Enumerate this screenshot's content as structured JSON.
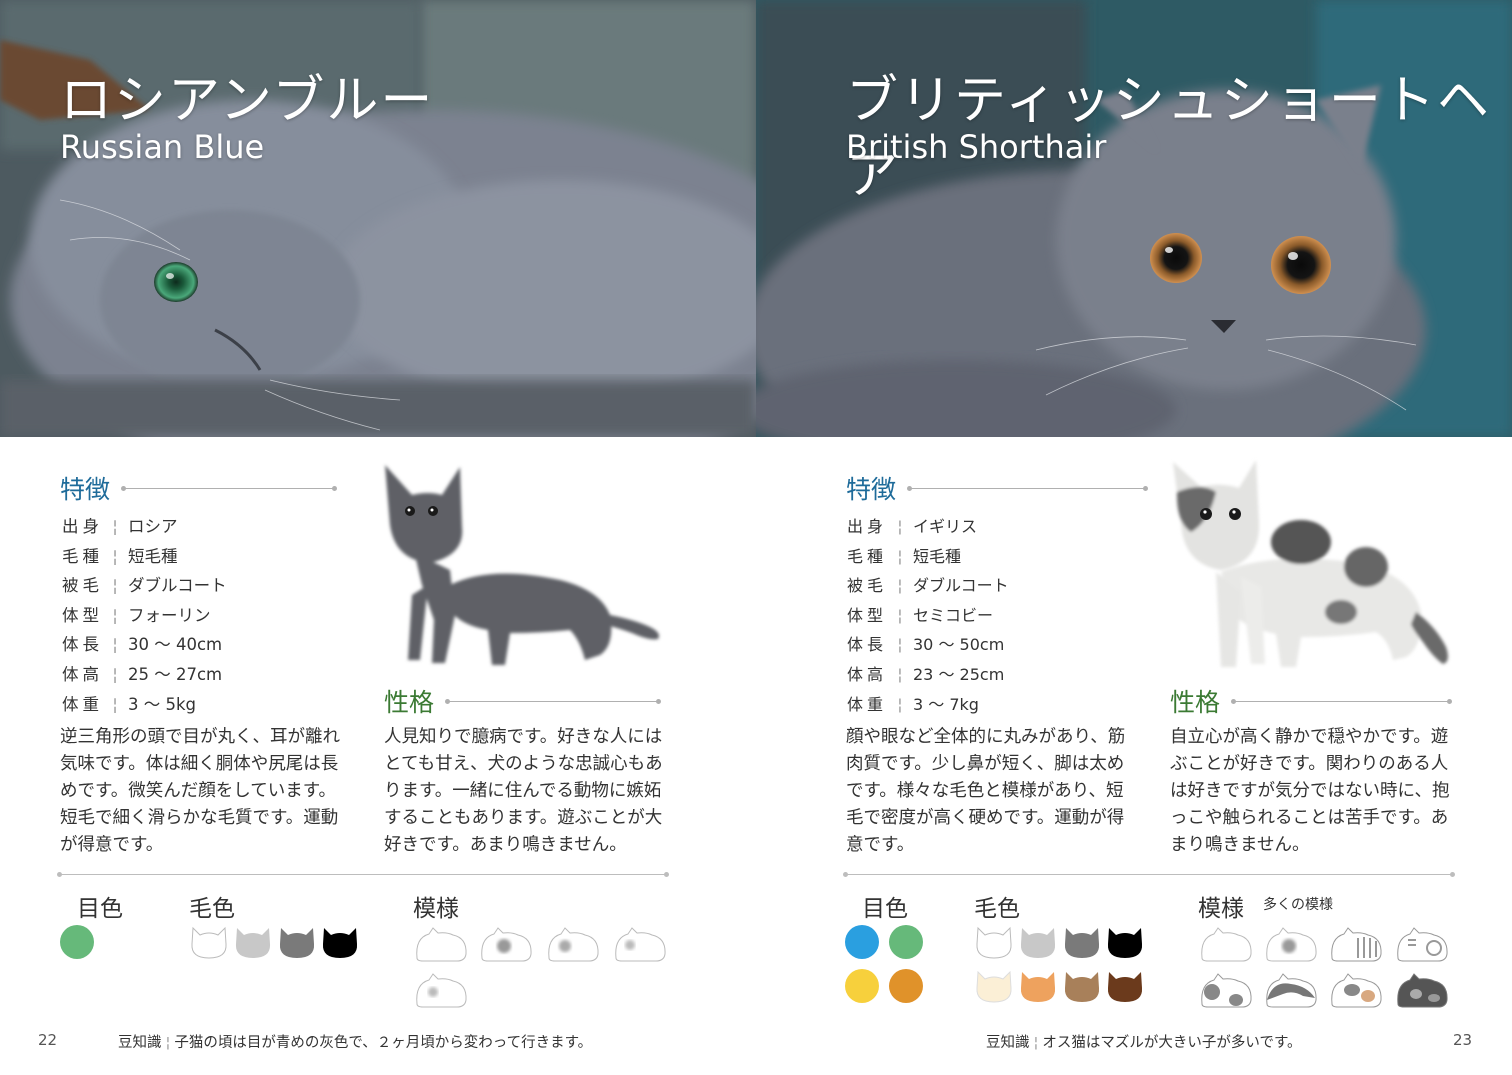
{
  "left": {
    "title_ja": "ロシアンブルー",
    "title_en": "Russian Blue",
    "features_heading": "特徴",
    "specs": [
      {
        "key": "出身",
        "value": "ロシア"
      },
      {
        "key": "毛種",
        "value": "短毛種"
      },
      {
        "key": "被毛",
        "value": "ダブルコート"
      },
      {
        "key": "体型",
        "value": "フォーリン"
      },
      {
        "key": "体長",
        "value": "30 〜 40cm"
      },
      {
        "key": "体高",
        "value": "25 〜 27cm"
      },
      {
        "key": "体重",
        "value": "3 〜 5kg"
      }
    ],
    "description": "逆三角形の頭で目が丸く、耳が離れ気味です。体は細く胴体や尻尾は長めです。微笑んだ顔をしています。短毛で細く滑らかな毛質です。運動が得意です。",
    "personality_heading": "性格",
    "personality": "人見知りで臆病です。好きな人にはとても甘え、犬のような忠誠心もあります。一緒に住んでる動物に嫉妬することもあります。遊ぶことが大好きです。あまり鳴きません。",
    "eye_color_label": "目色",
    "coat_color_label": "毛色",
    "pattern_label": "模様",
    "eye_colors": [
      "#66b97a"
    ],
    "coat_colors": [
      "#ffffff",
      "#c8c8c8",
      "#7a7a7a",
      "#000000"
    ],
    "page_number": "22",
    "tip_label": "豆知識",
    "tip": "子猫の頃は目が青めの灰色で、２ヶ月頃から変わって行きます。"
  },
  "right": {
    "title_ja": "ブリティッシュショートヘア",
    "title_en": "British Shorthair",
    "features_heading": "特徴",
    "specs": [
      {
        "key": "出身",
        "value": "イギリス"
      },
      {
        "key": "毛種",
        "value": "短毛種"
      },
      {
        "key": "被毛",
        "value": "ダブルコート"
      },
      {
        "key": "体型",
        "value": "セミコビー"
      },
      {
        "key": "体長",
        "value": "30 〜 50cm"
      },
      {
        "key": "体高",
        "value": "23 〜 25cm"
      },
      {
        "key": "体重",
        "value": "3 〜 7kg"
      }
    ],
    "description": "顔や眼など全体的に丸みがあり、筋肉質です。少し鼻が短く、脚は太めです。様々な毛色と模様があり、短毛で密度が高く硬めです。運動が得意です。",
    "personality_heading": "性格",
    "personality": "自立心が高く静かで穏やかです。遊ぶことが好きです。関わりのある人は好きですが気分ではない時に、抱っこや触られることは苦手です。あまり鳴きません。",
    "eye_color_label": "目色",
    "coat_color_label": "毛色",
    "pattern_label": "模様",
    "pattern_note": "多くの模様",
    "eye_colors": [
      "#2a9fe0",
      "#66b97a",
      "#f7d03c",
      "#e0922a"
    ],
    "coat_colors": [
      "#ffffff",
      "#c8c8c8",
      "#7a7a7a",
      "#000000",
      "#fbefd6",
      "#eea25e",
      "#a8805a",
      "#6b3a1c"
    ],
    "page_number": "23",
    "tip_label": "豆知識",
    "tip": "オス猫はマズルが大きい子が多いです。"
  }
}
